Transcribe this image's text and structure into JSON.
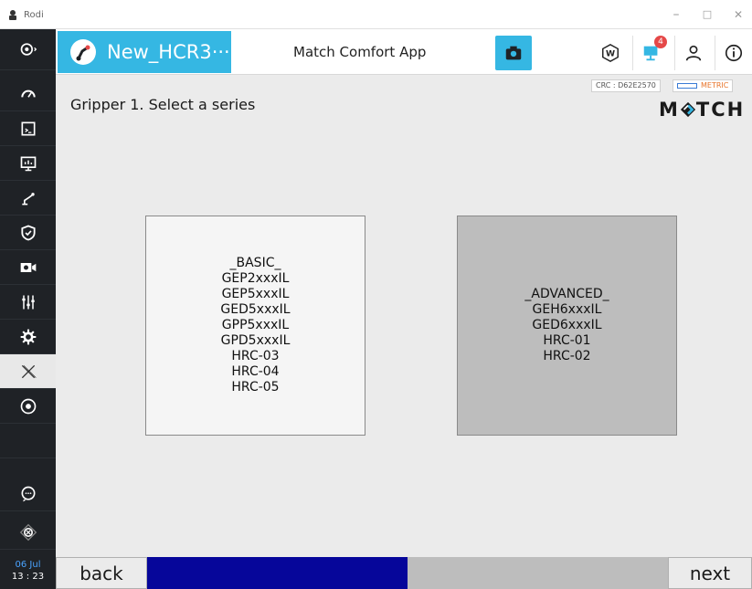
{
  "window": {
    "title": "Rodi",
    "controls": {
      "minimize": "–",
      "maximize": "□",
      "close": "✕"
    }
  },
  "sidebar": {
    "items": [
      {
        "icon": "logo-menu-icon"
      },
      {
        "icon": "speedometer-icon"
      },
      {
        "icon": "program-icon"
      },
      {
        "icon": "monitor-icon"
      },
      {
        "icon": "robot-arm-icon"
      },
      {
        "icon": "shield-icon"
      },
      {
        "icon": "camera-config-icon"
      },
      {
        "icon": "sliders-icon"
      },
      {
        "icon": "settings-icon"
      },
      {
        "icon": "x-app-icon",
        "active": true
      },
      {
        "icon": "record-icon"
      },
      {
        "icon": "blank"
      },
      {
        "icon": "chat-icon"
      },
      {
        "icon": "emergency-stop-icon"
      }
    ],
    "date": "06 Jul",
    "time": "13 : 23"
  },
  "topbar": {
    "project_name": "New_HCR3···",
    "app_name": "Match Comfort App",
    "notification_count": "4",
    "accent_color": "#35b7e3"
  },
  "content": {
    "title": "Gripper 1. Select a series",
    "crc": "CRC : D62E2570",
    "unit": "METRIC",
    "brand": {
      "left": "M",
      "right": "TCH"
    },
    "series": [
      {
        "name": "_BASIC_",
        "models": [
          "GEP2xxxIL",
          "GEP5xxxIL",
          "GED5xxxIL",
          "GPP5xxxIL",
          "GPD5xxxIL",
          "HRC-03",
          "HRC-04",
          "HRC-05"
        ]
      },
      {
        "name": "_ADVANCED_",
        "models": [
          "GEH6xxxIL",
          "GED6xxxIL",
          "HRC-01",
          "HRC-02"
        ]
      }
    ]
  },
  "footer": {
    "back_label": "back",
    "next_label": "next",
    "progress_fraction": 0.5,
    "progress_color": "#06069a"
  }
}
